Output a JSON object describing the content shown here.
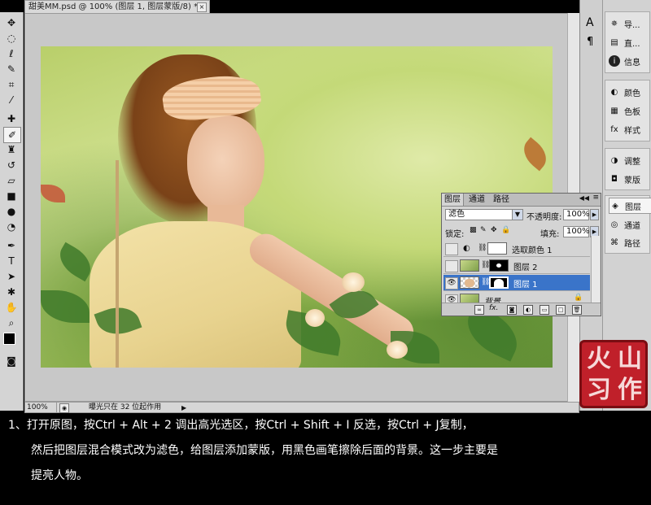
{
  "document": {
    "tab_title": "甜美MM.psd @ 100% (图层 1, 图层蒙版/8) *",
    "close_glyph": "×"
  },
  "status_bar": {
    "zoom": "100%",
    "message": "曝光只在 32 位起作用"
  },
  "right_panel": {
    "column1_icons": [
      "text-a-icon",
      "paragraph-icon"
    ],
    "groups": [
      {
        "items": [
          {
            "icon": "navigator-icon",
            "label": "导..."
          },
          {
            "icon": "histogram-icon",
            "label": "直..."
          },
          {
            "icon": "info-icon",
            "label": "信息"
          }
        ]
      },
      {
        "items": [
          {
            "icon": "color-icon",
            "label": "颜色"
          },
          {
            "icon": "swatches-icon",
            "label": "色板"
          },
          {
            "icon": "styles-icon",
            "label": "样式"
          }
        ]
      },
      {
        "items": [
          {
            "icon": "adjustments-icon",
            "label": "调整"
          },
          {
            "icon": "masks-icon",
            "label": "蒙版"
          }
        ]
      },
      {
        "items": [
          {
            "icon": "layers-icon",
            "label": "图层"
          },
          {
            "icon": "channels-icon",
            "label": "通道"
          },
          {
            "icon": "paths-icon",
            "label": "路径"
          }
        ]
      }
    ]
  },
  "layers_panel": {
    "tabs": [
      "图层",
      "通道",
      "路径"
    ],
    "blend_mode": "滤色",
    "opacity_label": "不透明度:",
    "opacity_value": "100%",
    "lock_label": "锁定:",
    "fill_label": "填充:",
    "fill_value": "100%",
    "layers": [
      {
        "name": "选取颜色 1",
        "visible": false,
        "selected": false,
        "type": "adjustment"
      },
      {
        "name": "图层 2",
        "visible": false,
        "selected": false,
        "type": "pixel"
      },
      {
        "name": "图层 1",
        "visible": true,
        "selected": true,
        "type": "pixel"
      },
      {
        "name": "背景",
        "visible": true,
        "selected": false,
        "type": "background"
      }
    ]
  },
  "stamp": {
    "chars": [
      "火",
      "山",
      "习",
      "作"
    ]
  },
  "caption": {
    "line1": "1、打开原图，按Ctrl + Alt + 2 调出高光选区，按Ctrl + Shift + I 反选，按Ctrl + J复制，",
    "line2": "然后把图层混合模式改为滤色，给图层添加蒙版，用黑色画笔擦除后面的背景。这一步主要是",
    "line3": "提亮人物。"
  },
  "colors": {
    "selection_blue": "#3a74c9",
    "stamp_red": "#c0202a"
  }
}
